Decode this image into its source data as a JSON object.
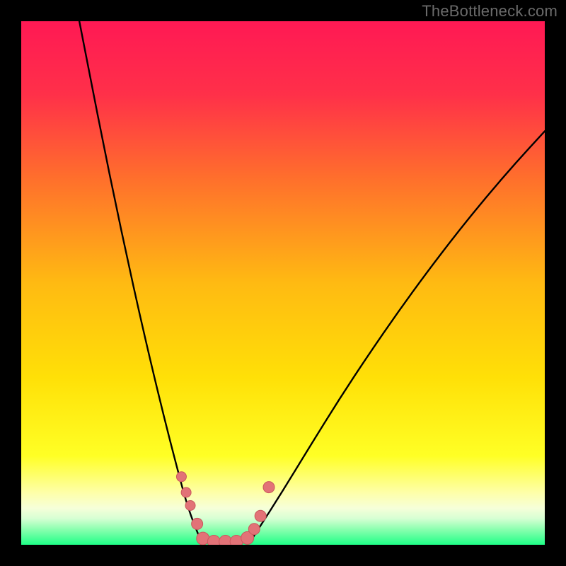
{
  "watermark": "TheBottleneck.com",
  "colors": {
    "frame": "#000000",
    "gradient_stops": [
      {
        "pct": 0,
        "color": "#ff1954"
      },
      {
        "pct": 14,
        "color": "#ff3049"
      },
      {
        "pct": 30,
        "color": "#ff6f2c"
      },
      {
        "pct": 50,
        "color": "#ffba12"
      },
      {
        "pct": 68,
        "color": "#ffe007"
      },
      {
        "pct": 83,
        "color": "#ffff25"
      },
      {
        "pct": 90,
        "color": "#feffa8"
      },
      {
        "pct": 93,
        "color": "#f6ffd9"
      },
      {
        "pct": 95,
        "color": "#d6ffd3"
      },
      {
        "pct": 97,
        "color": "#8dffb0"
      },
      {
        "pct": 100,
        "color": "#1fff87"
      }
    ],
    "curve": "#000000",
    "dot_fill": "#e27277",
    "dot_stroke": "#c9575c"
  },
  "chart_data": {
    "type": "line",
    "title": "",
    "xlabel": "",
    "ylabel": "",
    "xlim": [
      0,
      100
    ],
    "ylim": [
      0,
      100
    ],
    "note": "Axes are unlabeled in the image; x and y are normalized 0–100. Values are read off the plot geometry.",
    "series": [
      {
        "name": "left_branch",
        "x": [
          11.1,
          13.4,
          15.7,
          18.0,
          20.3,
          22.6,
          24.9,
          27.2,
          29.5,
          31.8,
          34.2
        ],
        "y": [
          100.0,
          88.2,
          76.5,
          65.3,
          54.5,
          44.1,
          34.2,
          24.7,
          15.7,
          7.1,
          1.0
        ]
      },
      {
        "name": "valley",
        "x": [
          34.2,
          36.0,
          38.0,
          40.0,
          42.0,
          44.0
        ],
        "y": [
          1.0,
          0.5,
          0.5,
          0.5,
          0.6,
          1.0
        ]
      },
      {
        "name": "right_branch",
        "x": [
          44.0,
          49.6,
          55.2,
          60.8,
          66.4,
          72.0,
          77.6,
          83.2,
          88.8,
          94.4,
          100.0
        ],
        "y": [
          1.0,
          9.7,
          18.9,
          27.9,
          36.4,
          44.5,
          52.2,
          59.5,
          66.4,
          72.9,
          79.0
        ]
      }
    ],
    "scatter": {
      "name": "dots",
      "points": [
        {
          "x": 30.6,
          "y": 13.0,
          "r": 7
        },
        {
          "x": 31.5,
          "y": 10.0,
          "r": 7
        },
        {
          "x": 32.3,
          "y": 7.5,
          "r": 7
        },
        {
          "x": 33.6,
          "y": 4.0,
          "r": 8
        },
        {
          "x": 34.7,
          "y": 1.2,
          "r": 9
        },
        {
          "x": 36.8,
          "y": 0.6,
          "r": 9
        },
        {
          "x": 39.0,
          "y": 0.6,
          "r": 9
        },
        {
          "x": 41.1,
          "y": 0.6,
          "r": 9
        },
        {
          "x": 43.2,
          "y": 1.3,
          "r": 9
        },
        {
          "x": 44.5,
          "y": 3.0,
          "r": 8
        },
        {
          "x": 45.7,
          "y": 5.5,
          "r": 8
        },
        {
          "x": 47.3,
          "y": 11.0,
          "r": 8
        }
      ]
    }
  }
}
